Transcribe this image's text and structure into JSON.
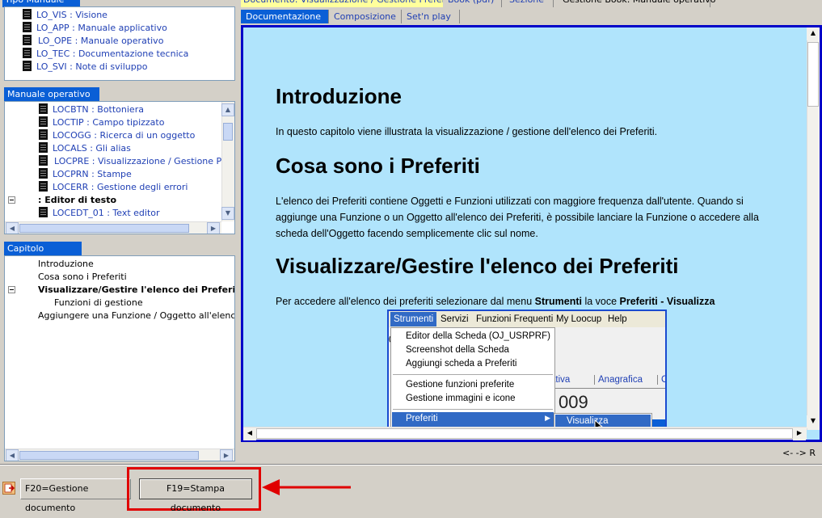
{
  "top_tabs": {
    "left_title": "Tipo Manuale",
    "document": "Documento: Visualizzazione / Gestione Preferiti",
    "book": "Book (pdf)",
    "sezione": "Sezione",
    "gestione": "Gestione Book: Manuale operativo"
  },
  "tipo_manuale": {
    "items": [
      "LO_VIS : Visione",
      "LO_APP : Manuale applicativo",
      "LO_OPE : Manuale operativo",
      "LO_TEC : Documentazione tecnica",
      "LO_SVI : Note di sviluppo"
    ]
  },
  "manuale_operativo": {
    "title": "Manuale operativo",
    "items": [
      "LOCBTN : Bottoniera",
      "LOCTIP : Campo tipizzato",
      "LOCOGG : Ricerca di un oggetto",
      "LOCALS : Gli alias",
      "LOCPRE : Visualizzazione / Gestione Preferiti",
      "LOCPRN : Stampe",
      "LOCERR : Gestione degli errori",
      ": Editor di testo",
      "LOCEDT_01 : Text editor"
    ]
  },
  "capitolo": {
    "title": "Capitolo",
    "items": [
      "Introduzione",
      "Cosa sono i Preferiti",
      "Visualizzare/Gestire l'elenco dei Preferiti",
      "Funzioni di gestione",
      "Aggiungere una Funzione / Oggetto all'elenco dei Preferiti"
    ]
  },
  "doc_tabs": [
    "Documentazione",
    "Composizione",
    "Set'n play"
  ],
  "document": {
    "h1": "Introduzione",
    "p1": "In questo capitolo viene illustrata la visualizzazione / gestione dell'elenco dei Preferiti.",
    "h2": "Cosa sono i Preferiti",
    "p2": "L'elenco dei Preferiti contiene Oggetti e Funzioni utilizzati con maggiore frequenza dall'utente. Quando si aggiunge una Funzione o un Oggetto all'elenco dei Preferiti, è possibile lanciare la Funzione o accedere alla scheda dell'Oggetto facendo semplicemente clic sul nome.",
    "h3": "Visualizzare/Gestire l'elenco dei Preferiti",
    "p3_prefix": "Per accedere all'elenco dei preferiti selezionare dal menu ",
    "p3_bold1": "Strumenti",
    "p3_mid": " la voce ",
    "p3_bold2": "Preferiti - Visualizza"
  },
  "menu_screenshot": {
    "menubar": [
      "Strumenti",
      "Servizi",
      "Funzioni Frequenti",
      "My Loocup",
      "Help"
    ],
    "items_group1": [
      "Editor della Scheda (OJ_USRPRF)",
      "Screenshot della Scheda",
      "Aggiungi scheda a Preferiti"
    ],
    "items_group2": [
      "Gestione funzioni preferite",
      "Gestione immagini e icone"
    ],
    "preferiti": "Preferiti",
    "submenu": "Visualizza",
    "bg_tabs": [
      "ativa",
      "Anagrafica",
      "C"
    ],
    "bg_number": "009",
    "bg_zero": "0"
  },
  "status_right": "<- -> R",
  "bottom_buttons": {
    "f20": "F20=Gestione documento",
    "f19": "F19=Stampa documento"
  },
  "colors": {
    "highlight_red": "#e00000",
    "selection_blue": "#316ac5",
    "content_bg": "#b0e4fc"
  }
}
